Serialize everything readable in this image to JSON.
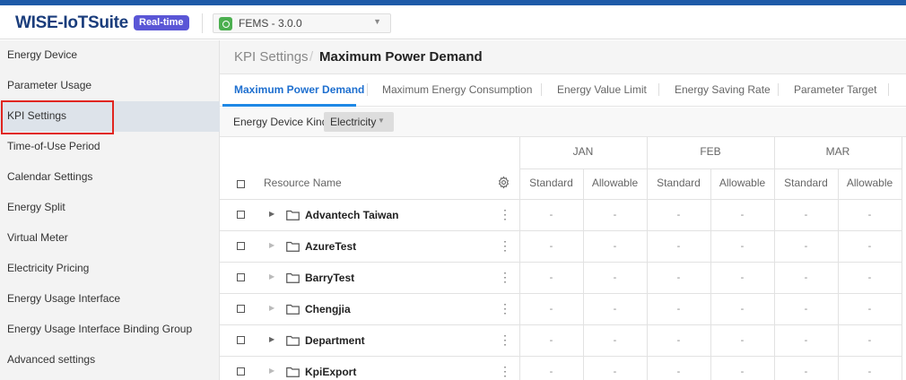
{
  "header": {
    "logo": "WISE-IoTSuite",
    "badge": "Real-time",
    "app_selector": "FEMS - 3.0.0"
  },
  "sidebar": {
    "items": [
      {
        "label": "Energy Device"
      },
      {
        "label": "Parameter Usage"
      },
      {
        "label": "KPI Settings",
        "active": true
      },
      {
        "label": "Time-of-Use Period"
      },
      {
        "label": "Calendar Settings"
      },
      {
        "label": "Energy Split"
      },
      {
        "label": "Virtual Meter"
      },
      {
        "label": "Electricity Pricing"
      },
      {
        "label": "Energy Usage Interface"
      },
      {
        "label": "Energy Usage Interface Binding Group"
      },
      {
        "label": "Advanced settings"
      }
    ]
  },
  "breadcrumb": {
    "parent": "KPI Settings",
    "separator": "/",
    "current": "Maximum Power Demand"
  },
  "tabs": [
    {
      "label": "Maximum Power Demand",
      "active": true
    },
    {
      "label": "Maximum Energy Consumption"
    },
    {
      "label": "Energy Value Limit"
    },
    {
      "label": "Energy Saving Rate"
    },
    {
      "label": "Parameter Target"
    }
  ],
  "filter": {
    "label": "Energy Device Kind",
    "value": "Electricity"
  },
  "table": {
    "resource_header": "Resource Name",
    "months": [
      "JAN",
      "FEB",
      "MAR"
    ],
    "subcolumns": [
      "Standard",
      "Allowable"
    ],
    "rows": [
      {
        "name": "Advantech Taiwan",
        "expandable": true,
        "values": [
          "-",
          "-",
          "-",
          "-",
          "-",
          "-"
        ]
      },
      {
        "name": "AzureTest",
        "expandable": false,
        "values": [
          "-",
          "-",
          "-",
          "-",
          "-",
          "-"
        ]
      },
      {
        "name": "BarryTest",
        "expandable": false,
        "values": [
          "-",
          "-",
          "-",
          "-",
          "-",
          "-"
        ]
      },
      {
        "name": "Chengjia",
        "expandable": false,
        "values": [
          "-",
          "-",
          "-",
          "-",
          "-",
          "-"
        ]
      },
      {
        "name": "Department",
        "expandable": true,
        "values": [
          "-",
          "-",
          "-",
          "-",
          "-",
          "-"
        ]
      },
      {
        "name": "KpiExport",
        "expandable": false,
        "values": [
          "-",
          "-",
          "-",
          "-",
          "-",
          "-"
        ]
      }
    ]
  },
  "icons": {
    "app": "fems-app-icon",
    "settings": "gear-icon",
    "row_menu": "kebab-menu-icon",
    "folder": "folder-icon",
    "expand": "caret-right-icon"
  },
  "colors": {
    "accent": "#1e88e5",
    "badge": "#5a56d6",
    "highlight_box": "#e0251f",
    "logo": "#1a3d7c"
  }
}
